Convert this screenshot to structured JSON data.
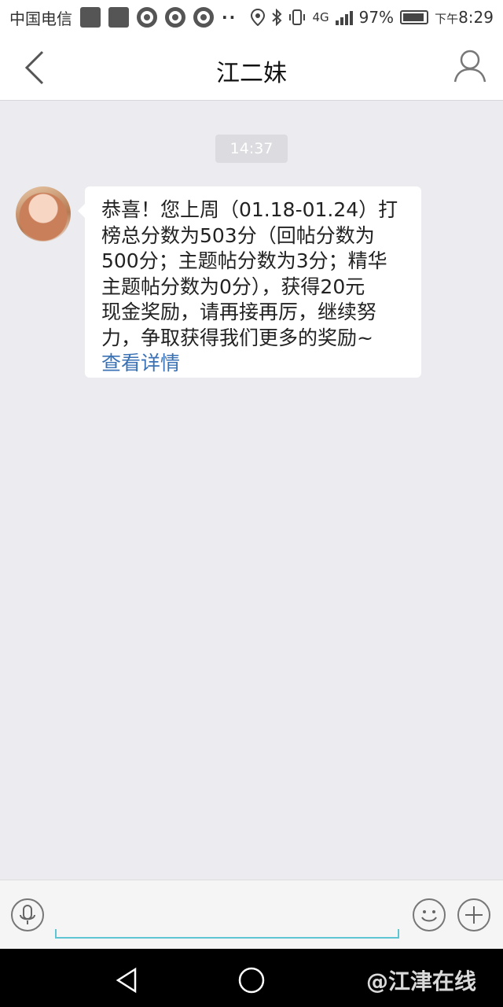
{
  "status_bar": {
    "carrier": "中国电信",
    "dots": "··",
    "network": "4G",
    "battery_percent": "97%",
    "time_prefix": "下午",
    "time": "8:29"
  },
  "header": {
    "title": "江二妹"
  },
  "conversation": {
    "timestamp": "14:37",
    "message_lines": [
      "恭喜！您上周（01.18-01.24）打",
      "榜总分数为503分（回帖分数为",
      "500分；主题帖分数为3分；精华",
      "主题帖分数为0分），获得20元",
      "现金奖励，请再接再厉，继续努",
      "力，争取获得我们更多的奖励~"
    ],
    "link_text": "查看详情"
  },
  "input_bar": {
    "value": "",
    "placeholder": ""
  },
  "watermark": "@江津在线",
  "colors": {
    "background": "#ebebf0",
    "link": "#3a72b5",
    "input_underline": "#5fc5d3"
  }
}
